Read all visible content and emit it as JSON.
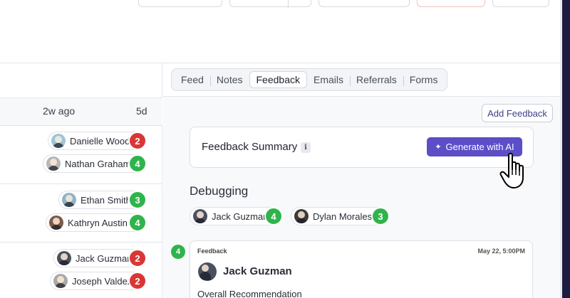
{
  "left_panel": {
    "header": {
      "col1": "2w ago",
      "col2": "5d"
    },
    "rows": [
      {
        "name": "Danielle Wood",
        "score": "2",
        "score_color": "#d93636"
      },
      {
        "name": "Nathan Graham",
        "score": "4",
        "score_color": "#2fb44c"
      },
      {
        "name": "Ethan Smith",
        "score": "3",
        "score_color": "#2fb44c"
      },
      {
        "name": "Kathryn Austin",
        "score": "4",
        "score_color": "#2fb44c"
      },
      {
        "name": "Jack Guzman",
        "score": "2",
        "score_color": "#d93636"
      },
      {
        "name": "Joseph Valdez",
        "score": "2",
        "score_color": "#d93636"
      }
    ]
  },
  "tabs": [
    {
      "label": "Feed",
      "active": false
    },
    {
      "label": "Notes",
      "active": false
    },
    {
      "label": "Feedback",
      "active": true
    },
    {
      "label": "Emails",
      "active": false
    },
    {
      "label": "Referrals",
      "active": false
    },
    {
      "label": "Forms",
      "active": false
    }
  ],
  "feedback": {
    "add_button": "Add Feedback",
    "summary": {
      "title": "Feedback Summary",
      "info_icon": "i",
      "generate_button": "Generate with AI",
      "generate_icon": "sparkle-icon"
    },
    "section_title": "Debugging",
    "interviewers": [
      {
        "name": "Jack Guzman",
        "score": "4"
      },
      {
        "name": "Dylan Morales",
        "score": "3"
      }
    ],
    "card": {
      "score": "4",
      "label": "Feedback",
      "date": "May 22, 5:00PM",
      "author": "Jack Guzman",
      "subheading": "Overall Recommendation"
    }
  },
  "colors": {
    "accent": "#5b4ec7",
    "red": "#d93636",
    "green": "#2fb44c",
    "dark_strip": "#1d1b3f"
  }
}
